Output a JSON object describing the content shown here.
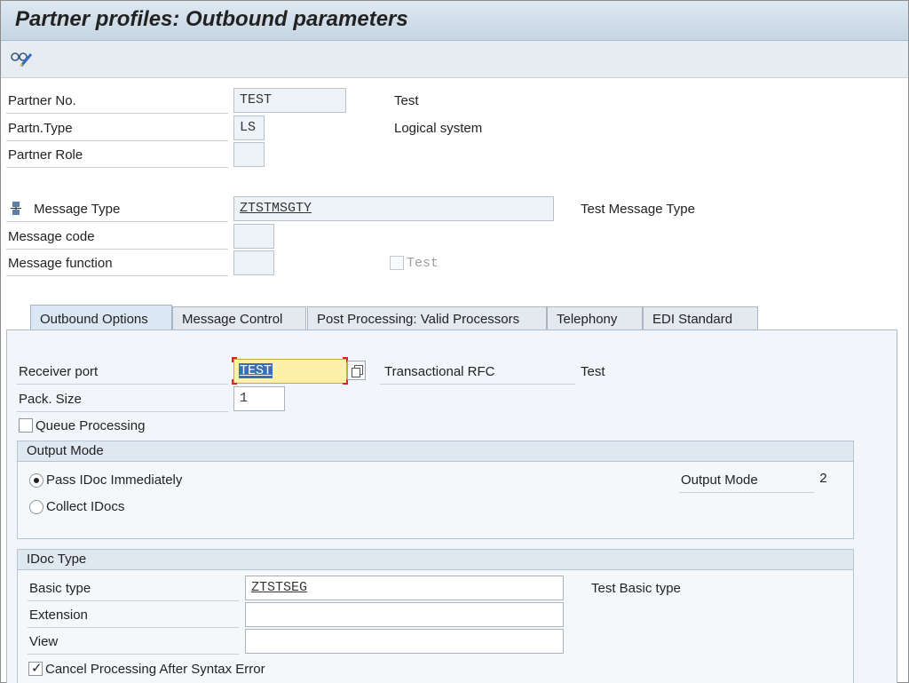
{
  "window": {
    "title": "Partner profiles: Outbound parameters"
  },
  "toolbar": {
    "display_change_icon": "glasses-pencil-icon"
  },
  "partner": {
    "partner_no_label": "Partner No.",
    "partner_no_value": "TEST",
    "partner_no_desc": "Test",
    "partn_type_label": "Partn.Type",
    "partn_type_value": "LS",
    "partn_type_desc": "Logical system",
    "partner_role_label": "Partner Role",
    "partner_role_value": ""
  },
  "message": {
    "message_type_icon": "message-type-icon",
    "message_type_label": "Message Type",
    "message_type_value": "ZTSTMSGTY",
    "message_type_desc": "Test Message Type",
    "message_code_label": "Message code",
    "message_code_value": "",
    "message_function_label": "Message function",
    "message_function_value": "",
    "test_checkbox_label": "Test"
  },
  "tabs": [
    {
      "label": "Outbound Options",
      "active": true
    },
    {
      "label": "Message Control",
      "active": false
    },
    {
      "label": "Post Processing: Valid Processors",
      "active": false
    },
    {
      "label": "Telephony",
      "active": false
    },
    {
      "label": "EDI Standard",
      "active": false
    }
  ],
  "outbound": {
    "receiver_port_label": "Receiver port",
    "receiver_port_value": "TEST",
    "receiver_port_type": "Transactional RFC",
    "receiver_port_desc": "Test",
    "pack_size_label": "Pack. Size",
    "pack_size_value": "1",
    "queue_processing_label": "Queue Processing",
    "queue_processing_checked": false
  },
  "output_mode": {
    "header": "Output Mode",
    "pass_immediately_label": "Pass IDoc Immediately",
    "collect_idocs_label": "Collect IDocs",
    "selected": "pass_immediately",
    "output_mode_label": "Output Mode",
    "output_mode_value": "2"
  },
  "idoc_type": {
    "header": "IDoc Type",
    "basic_type_label": "Basic type",
    "basic_type_value": "ZTSTSEG",
    "basic_type_desc": "Test Basic type",
    "extension_label": "Extension",
    "extension_value": "",
    "view_label": "View",
    "view_value": "",
    "cancel_processing_label": "Cancel Processing After Syntax Error",
    "cancel_processing_checked": true
  }
}
